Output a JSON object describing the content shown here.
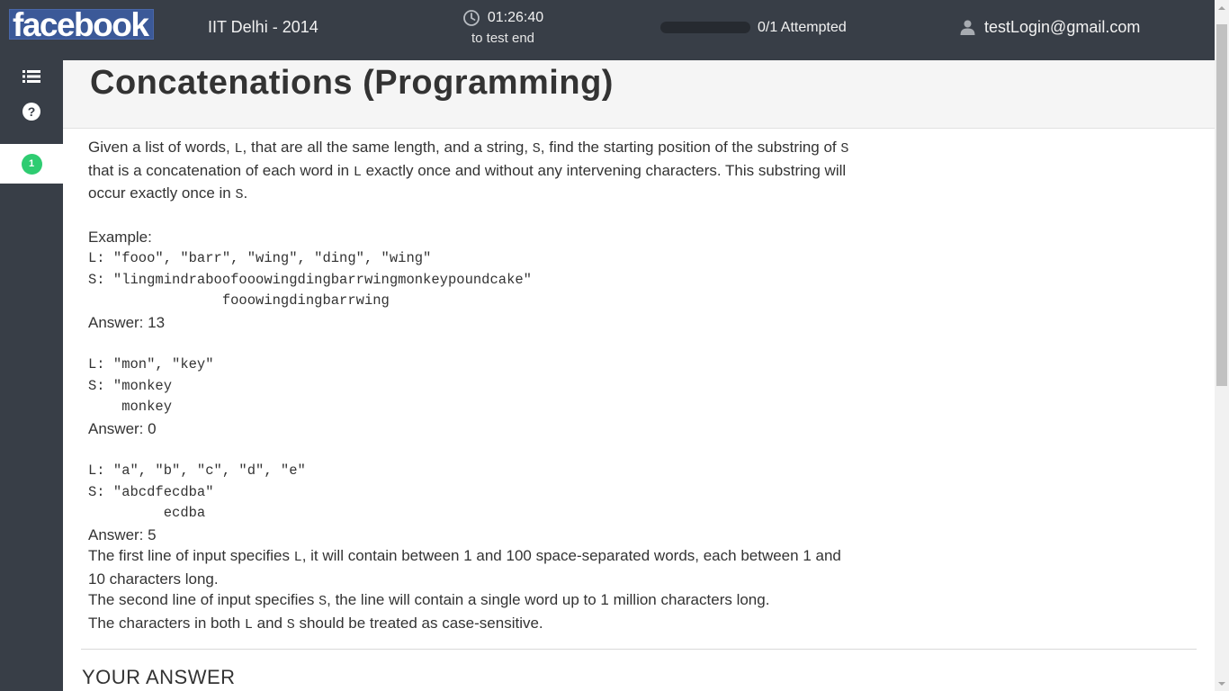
{
  "header": {
    "logo_text": "facebook",
    "test_name": "IIT Delhi - 2014",
    "timer": "01:26:40",
    "timer_sub": "to test end",
    "attempted": "0/1 Attempted",
    "progress_fraction": 0,
    "user_email": "testLogin@gmail.com"
  },
  "sidebar": {
    "question_number": "1"
  },
  "question": {
    "title": "Concatenations (Programming)",
    "intro": [
      {
        "t": "Given a list of words, "
      },
      {
        "t": "L",
        "m": true
      },
      {
        "t": ", that are all the same length, and a string, "
      },
      {
        "t": "S",
        "m": true
      },
      {
        "t": ", find the starting position of the substring of "
      },
      {
        "t": "S",
        "m": true
      },
      {
        "t": " that is a concatenation of each word in "
      },
      {
        "t": "L",
        "m": true
      },
      {
        "t": " exactly once and without any intervening characters.  This substring will occur exactly once in "
      },
      {
        "t": "S",
        "m": true
      },
      {
        "t": "."
      }
    ],
    "example_label": "Example:",
    "example1_l": "L: \"fooo\", \"barr\", \"wing\", \"ding\", \"wing\"",
    "example1_s": "S: \"lingmindraboofooowingdingbarrwingmonkeypoundcake\"",
    "example1_match": "                fooowingdingbarrwing",
    "example1_answer": "Answer: 13",
    "example2_l": "L: \"mon\", \"key\"",
    "example2_s": "S: \"monkey",
    "example2_match": "    monkey",
    "example2_answer": "Answer: 0",
    "example3_l": "L: \"a\", \"b\", \"c\", \"d\", \"e\"",
    "example3_s": "S: \"abcdfecdba\"",
    "example3_match": "         ecdba",
    "example3_answer": "Answer: 5",
    "input_line1": [
      {
        "t": "The first line of input specifies "
      },
      {
        "t": "L",
        "m": true
      },
      {
        "t": ", it will contain between 1 and 100 space-separated words, each between 1 and 10 characters long."
      }
    ],
    "input_line2": [
      {
        "t": "The second line of input specifies "
      },
      {
        "t": "S",
        "m": true
      },
      {
        "t": ", the line will contain a single word up to 1 million characters long."
      }
    ],
    "input_line3": [
      {
        "t": "The characters in both "
      },
      {
        "t": "L",
        "m": true
      },
      {
        "t": " and "
      },
      {
        "t": "S",
        "m": true
      },
      {
        "t": " should be treated as case-sensitive."
      }
    ]
  },
  "answer_heading": "YOUR ANSWER",
  "colors": {
    "topbar": "#383e47",
    "logo_bg": "#3b5998",
    "badge": "#2ecc71"
  }
}
